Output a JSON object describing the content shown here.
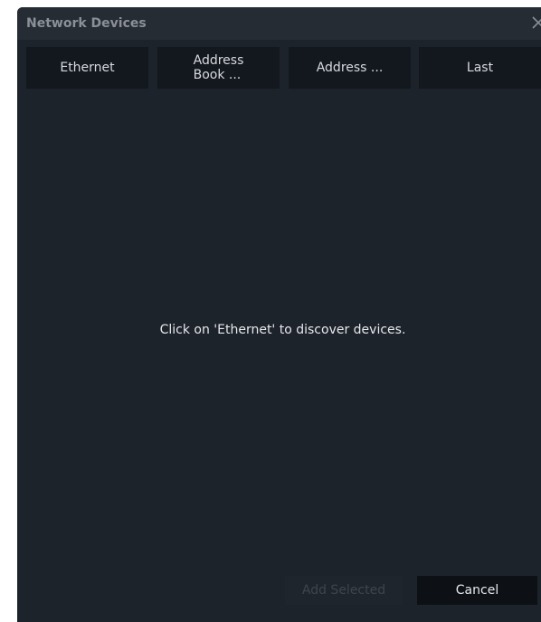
{
  "window": {
    "title": "Network Devices",
    "close_icon": "close-icon"
  },
  "tabs": [
    {
      "label": "Ethernet"
    },
    {
      "label": "Address\nBook ..."
    },
    {
      "label": "Address ..."
    },
    {
      "label": "Last"
    }
  ],
  "main": {
    "empty_message": "Click on 'Ethernet' to discover devices."
  },
  "footer": {
    "add_selected_label": "Add Selected",
    "add_selected_enabled": false,
    "cancel_label": "Cancel"
  },
  "colors": {
    "dialog_background": "#1d232b",
    "title_bar": "#262c34",
    "tab_background": "#13181e",
    "button_dark": "#0d1116",
    "text": "#e6e8eb",
    "disabled_text": "#3e454e"
  }
}
